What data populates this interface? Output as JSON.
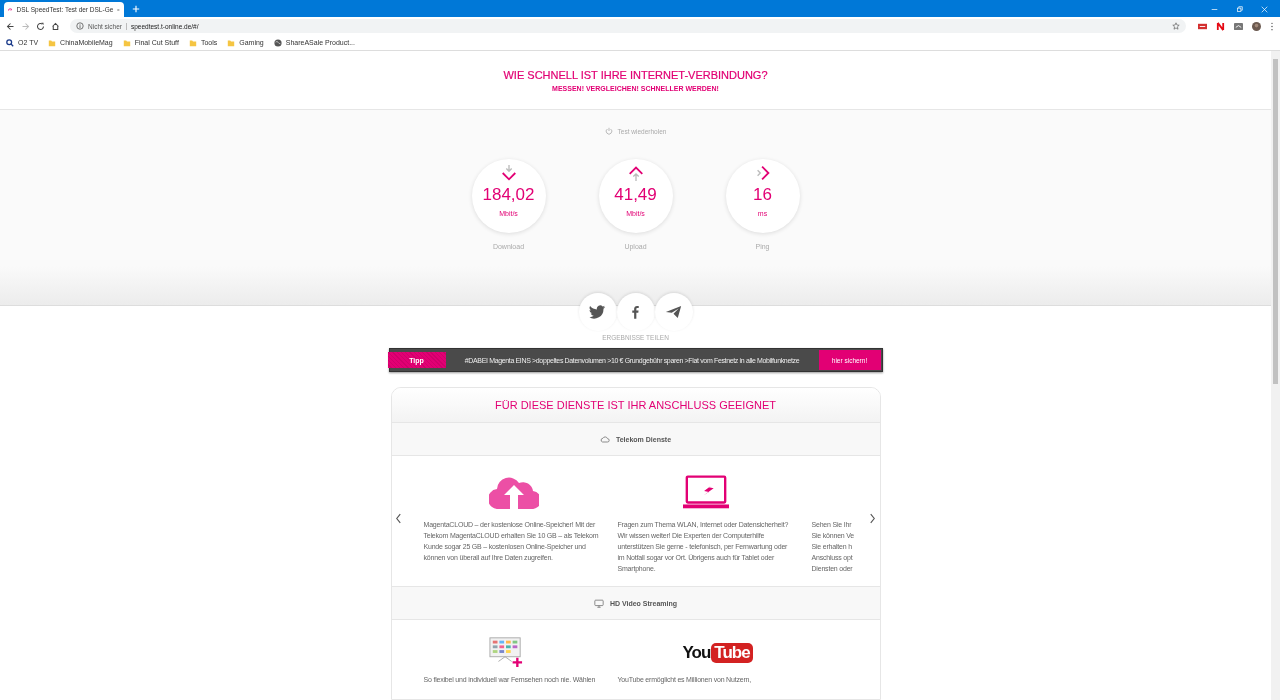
{
  "browser": {
    "tab": {
      "title": "DSL SpeedTest: Test der DSL-Ge"
    },
    "nav": [
      {
        "kind": "back",
        "disabled": false
      },
      {
        "kind": "forward",
        "disabled": true
      },
      {
        "kind": "reload",
        "disabled": false
      },
      {
        "kind": "home",
        "disabled": false
      }
    ],
    "address": {
      "security": "Nicht sicher",
      "url": "speedtest.t-online.de/#/"
    },
    "bookmarks": [
      {
        "kind": "search",
        "label": "O2 TV"
      },
      {
        "kind": "folder",
        "label": "ChinaMobileMag"
      },
      {
        "kind": "folder",
        "label": "Final Cut Stuff"
      },
      {
        "kind": "folder",
        "label": "Tools"
      },
      {
        "kind": "folder",
        "label": "Gaming"
      },
      {
        "kind": "globe",
        "label": "ShareASale Product..."
      }
    ]
  },
  "header": {
    "title": "WIE SCHNELL IST IHRE INTERNET-VERBINDUNG?",
    "subtitle": "MESSEN! VERGLEICHEN! SCHNELLER WERDEN!"
  },
  "repeat_test": "Test wiederholen",
  "results": [
    {
      "kind": "download",
      "value": "184,02",
      "unit": "Mbit/s",
      "label": "Download"
    },
    {
      "kind": "upload",
      "value": "41,49",
      "unit": "Mbit/s",
      "label": "Upload"
    },
    {
      "kind": "ping",
      "value": "16",
      "unit": "ms",
      "label": "Ping"
    }
  ],
  "share": {
    "label": "ERGEBNISSE TEILEN",
    "buttons": [
      {
        "kind": "twitter"
      },
      {
        "kind": "facebook"
      },
      {
        "kind": "send"
      }
    ]
  },
  "tip": {
    "badge": "Tipp",
    "text": "#DABEI Magenta EINS >doppeltes Datenvolumen >10 € Grundgebühr sparen >Flat vom Festnetz in alle Mobilfunknetze",
    "button": "hier sichern!"
  },
  "services": {
    "title": "FÜR DIESE DIENSTE IST IHR ANSCHLUSS GEEIGNET",
    "sections": [
      {
        "kind": "cloud",
        "title": "Telekom Dienste",
        "carousel": true,
        "items": [
          {
            "kind": "cloud",
            "lines": [
              "MagentaCLOUD – der kostenlose Online-Speicher! Mit der",
              "Telekom MagentaCLOUD erhalten Sie 10 GB – als Telekom",
              "Kunde sogar 25 GB – kostenlosen Online-Speicher und",
              "können von überall auf Ihre Daten zugreifen."
            ]
          },
          {
            "kind": "laptop",
            "lines": [
              "Fragen zum Thema WLAN, Internet oder Datensicherheit?",
              "Wir wissen weiter! Die Experten der Computerhilfe",
              "unterstützen Sie gerne - telefonisch, per Fernwartung oder",
              "im Notfall sogar vor Ort. Übrigens auch für Tablet oder",
              "Smartphone."
            ]
          },
          {
            "kind": "text",
            "lines": [
              "Sehen Sie Ihr",
              "Sie können Ve",
              "Sie erhalten h",
              "Anschluss opt",
              "Diensten oder"
            ]
          }
        ]
      },
      {
        "kind": "monitor",
        "title": "HD Video Streaming",
        "carousel": false,
        "items": [
          {
            "kind": "tv",
            "lines": [
              "So flexibel und individuell war Fernsehen noch nie. Wählen"
            ]
          },
          {
            "kind": "logo",
            "logo": [
              "You",
              "Tube"
            ],
            "lines": [
              "YouTube ermöglicht es Millionen von Nutzern,"
            ]
          }
        ]
      }
    ]
  }
}
